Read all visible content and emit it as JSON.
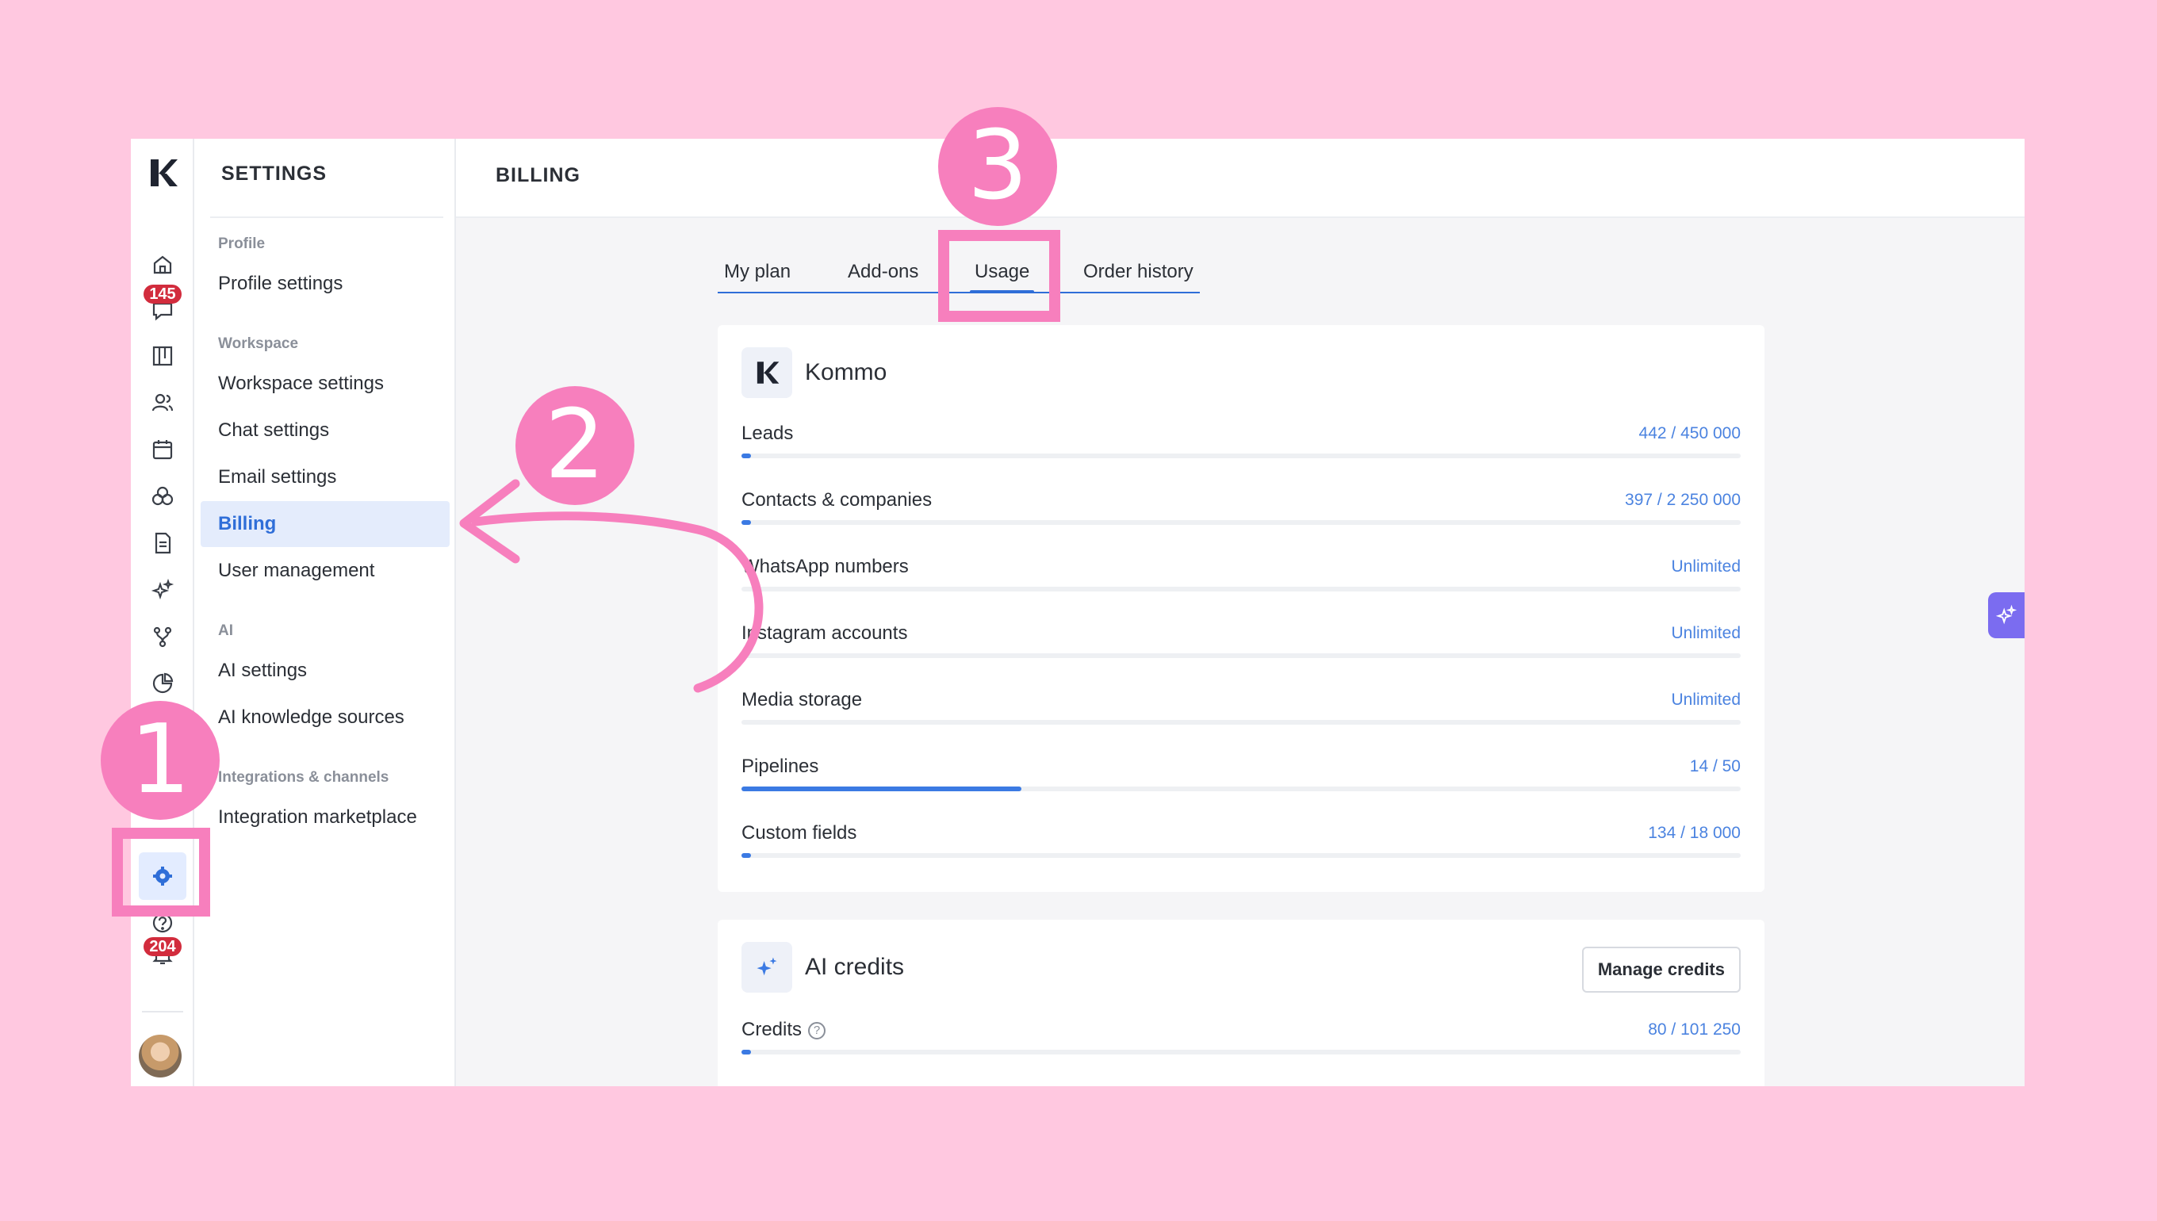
{
  "rail": {
    "items": [
      {
        "name": "home-icon"
      },
      {
        "name": "chats-icon",
        "badge": "145"
      },
      {
        "name": "leads-board-icon"
      },
      {
        "name": "contacts-icon"
      },
      {
        "name": "calendar-icon"
      },
      {
        "name": "catalog-icon"
      },
      {
        "name": "lists-icon"
      },
      {
        "name": "ai-sparkle-icon"
      },
      {
        "name": "automation-icon"
      },
      {
        "name": "stats-icon"
      },
      {
        "name": "settings-gear-icon"
      },
      {
        "name": "help-icon"
      },
      {
        "name": "notifications-bell-icon",
        "badge": "204"
      }
    ]
  },
  "sidebar": {
    "title": "SETTINGS",
    "sections": [
      {
        "label": "Profile",
        "items": [
          "Profile settings"
        ]
      },
      {
        "label": "Workspace",
        "items": [
          "Workspace settings",
          "Chat settings",
          "Email settings",
          "Billing",
          "User management"
        ]
      },
      {
        "label": "AI",
        "items": [
          "AI settings",
          "AI knowledge sources"
        ]
      },
      {
        "label": "Integrations & channels",
        "items": [
          "Integration marketplace"
        ]
      }
    ],
    "active_item": "Billing"
  },
  "main": {
    "title": "BILLING",
    "tabs": [
      "My plan",
      "Add-ons",
      "Usage",
      "Order history"
    ],
    "active_tab": "Usage"
  },
  "kommo_card": {
    "name": "Kommo",
    "rows": [
      {
        "label": "Leads",
        "value": "442 / 450 000",
        "fraction": 0.001
      },
      {
        "label": "Contacts & companies",
        "value": "397 / 2 250 000",
        "fraction": 0.0002
      },
      {
        "label": "WhatsApp numbers",
        "value": "Unlimited",
        "fraction": 0
      },
      {
        "label": "Instagram accounts",
        "value": "Unlimited",
        "fraction": 0
      },
      {
        "label": "Media storage",
        "value": "Unlimited",
        "fraction": 0
      },
      {
        "label": "Pipelines",
        "value": "14 / 50",
        "fraction": 0.28
      },
      {
        "label": "Custom fields",
        "value": "134 / 18 000",
        "fraction": 0.0075
      }
    ]
  },
  "ai_card": {
    "name": "AI credits",
    "button": "Manage credits",
    "rows": [
      {
        "label": "Credits",
        "value": "80 / 101 250",
        "fraction": 0.0008
      }
    ]
  },
  "annotations": {
    "steps": [
      "1",
      "2",
      "3"
    ],
    "color": "#f77fbd"
  },
  "colors": {
    "accent": "#2f6ed8",
    "value_blue": "#4b83e0",
    "badge_red": "#d22c3d",
    "background": "#ffc8e0"
  }
}
